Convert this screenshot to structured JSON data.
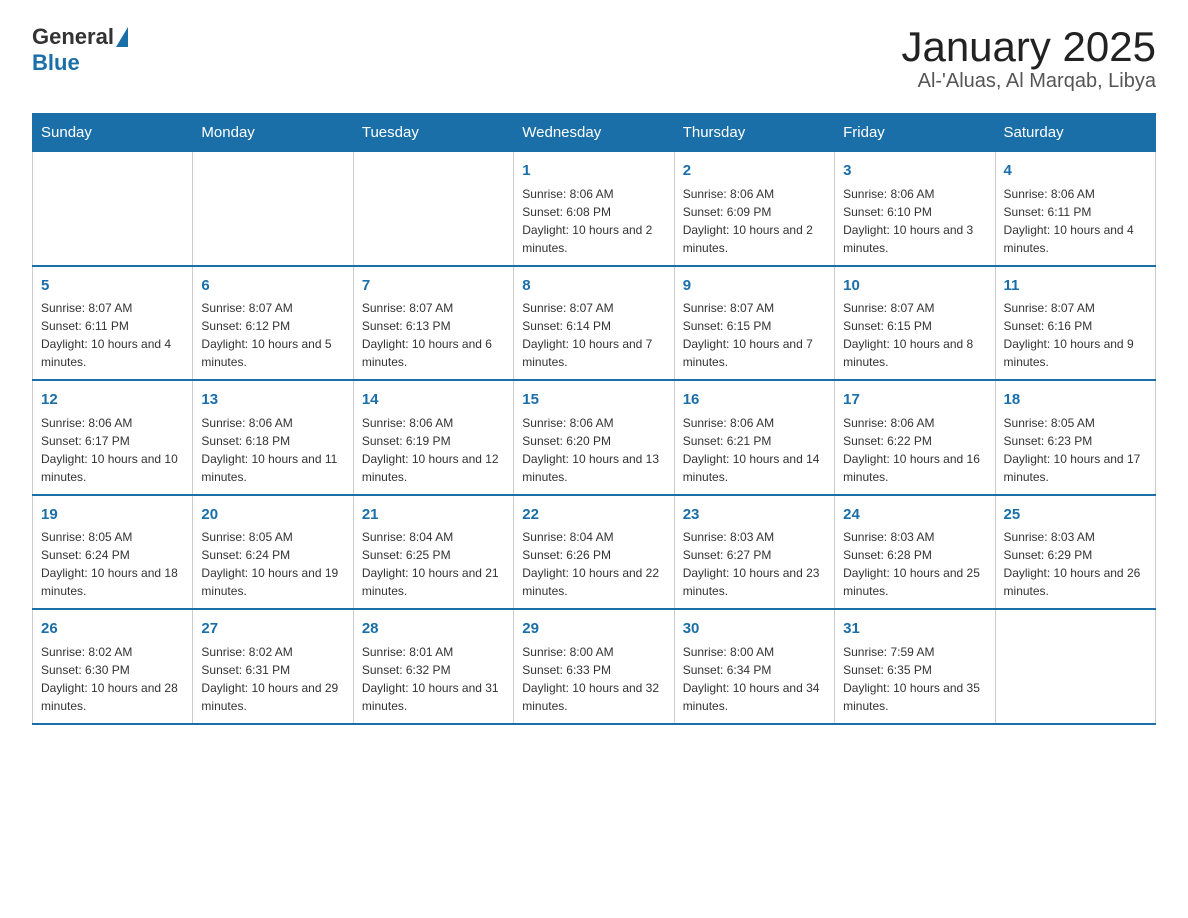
{
  "logo": {
    "general": "General",
    "blue": "Blue"
  },
  "title": "January 2025",
  "subtitle": "Al-'Aluas, Al Marqab, Libya",
  "days_of_week": [
    "Sunday",
    "Monday",
    "Tuesday",
    "Wednesday",
    "Thursday",
    "Friday",
    "Saturday"
  ],
  "weeks": [
    [
      {
        "day": "",
        "info": ""
      },
      {
        "day": "",
        "info": ""
      },
      {
        "day": "",
        "info": ""
      },
      {
        "day": "1",
        "info": "Sunrise: 8:06 AM\nSunset: 6:08 PM\nDaylight: 10 hours and 2 minutes."
      },
      {
        "day": "2",
        "info": "Sunrise: 8:06 AM\nSunset: 6:09 PM\nDaylight: 10 hours and 2 minutes."
      },
      {
        "day": "3",
        "info": "Sunrise: 8:06 AM\nSunset: 6:10 PM\nDaylight: 10 hours and 3 minutes."
      },
      {
        "day": "4",
        "info": "Sunrise: 8:06 AM\nSunset: 6:11 PM\nDaylight: 10 hours and 4 minutes."
      }
    ],
    [
      {
        "day": "5",
        "info": "Sunrise: 8:07 AM\nSunset: 6:11 PM\nDaylight: 10 hours and 4 minutes."
      },
      {
        "day": "6",
        "info": "Sunrise: 8:07 AM\nSunset: 6:12 PM\nDaylight: 10 hours and 5 minutes."
      },
      {
        "day": "7",
        "info": "Sunrise: 8:07 AM\nSunset: 6:13 PM\nDaylight: 10 hours and 6 minutes."
      },
      {
        "day": "8",
        "info": "Sunrise: 8:07 AM\nSunset: 6:14 PM\nDaylight: 10 hours and 7 minutes."
      },
      {
        "day": "9",
        "info": "Sunrise: 8:07 AM\nSunset: 6:15 PM\nDaylight: 10 hours and 7 minutes."
      },
      {
        "day": "10",
        "info": "Sunrise: 8:07 AM\nSunset: 6:15 PM\nDaylight: 10 hours and 8 minutes."
      },
      {
        "day": "11",
        "info": "Sunrise: 8:07 AM\nSunset: 6:16 PM\nDaylight: 10 hours and 9 minutes."
      }
    ],
    [
      {
        "day": "12",
        "info": "Sunrise: 8:06 AM\nSunset: 6:17 PM\nDaylight: 10 hours and 10 minutes."
      },
      {
        "day": "13",
        "info": "Sunrise: 8:06 AM\nSunset: 6:18 PM\nDaylight: 10 hours and 11 minutes."
      },
      {
        "day": "14",
        "info": "Sunrise: 8:06 AM\nSunset: 6:19 PM\nDaylight: 10 hours and 12 minutes."
      },
      {
        "day": "15",
        "info": "Sunrise: 8:06 AM\nSunset: 6:20 PM\nDaylight: 10 hours and 13 minutes."
      },
      {
        "day": "16",
        "info": "Sunrise: 8:06 AM\nSunset: 6:21 PM\nDaylight: 10 hours and 14 minutes."
      },
      {
        "day": "17",
        "info": "Sunrise: 8:06 AM\nSunset: 6:22 PM\nDaylight: 10 hours and 16 minutes."
      },
      {
        "day": "18",
        "info": "Sunrise: 8:05 AM\nSunset: 6:23 PM\nDaylight: 10 hours and 17 minutes."
      }
    ],
    [
      {
        "day": "19",
        "info": "Sunrise: 8:05 AM\nSunset: 6:24 PM\nDaylight: 10 hours and 18 minutes."
      },
      {
        "day": "20",
        "info": "Sunrise: 8:05 AM\nSunset: 6:24 PM\nDaylight: 10 hours and 19 minutes."
      },
      {
        "day": "21",
        "info": "Sunrise: 8:04 AM\nSunset: 6:25 PM\nDaylight: 10 hours and 21 minutes."
      },
      {
        "day": "22",
        "info": "Sunrise: 8:04 AM\nSunset: 6:26 PM\nDaylight: 10 hours and 22 minutes."
      },
      {
        "day": "23",
        "info": "Sunrise: 8:03 AM\nSunset: 6:27 PM\nDaylight: 10 hours and 23 minutes."
      },
      {
        "day": "24",
        "info": "Sunrise: 8:03 AM\nSunset: 6:28 PM\nDaylight: 10 hours and 25 minutes."
      },
      {
        "day": "25",
        "info": "Sunrise: 8:03 AM\nSunset: 6:29 PM\nDaylight: 10 hours and 26 minutes."
      }
    ],
    [
      {
        "day": "26",
        "info": "Sunrise: 8:02 AM\nSunset: 6:30 PM\nDaylight: 10 hours and 28 minutes."
      },
      {
        "day": "27",
        "info": "Sunrise: 8:02 AM\nSunset: 6:31 PM\nDaylight: 10 hours and 29 minutes."
      },
      {
        "day": "28",
        "info": "Sunrise: 8:01 AM\nSunset: 6:32 PM\nDaylight: 10 hours and 31 minutes."
      },
      {
        "day": "29",
        "info": "Sunrise: 8:00 AM\nSunset: 6:33 PM\nDaylight: 10 hours and 32 minutes."
      },
      {
        "day": "30",
        "info": "Sunrise: 8:00 AM\nSunset: 6:34 PM\nDaylight: 10 hours and 34 minutes."
      },
      {
        "day": "31",
        "info": "Sunrise: 7:59 AM\nSunset: 6:35 PM\nDaylight: 10 hours and 35 minutes."
      },
      {
        "day": "",
        "info": ""
      }
    ]
  ]
}
